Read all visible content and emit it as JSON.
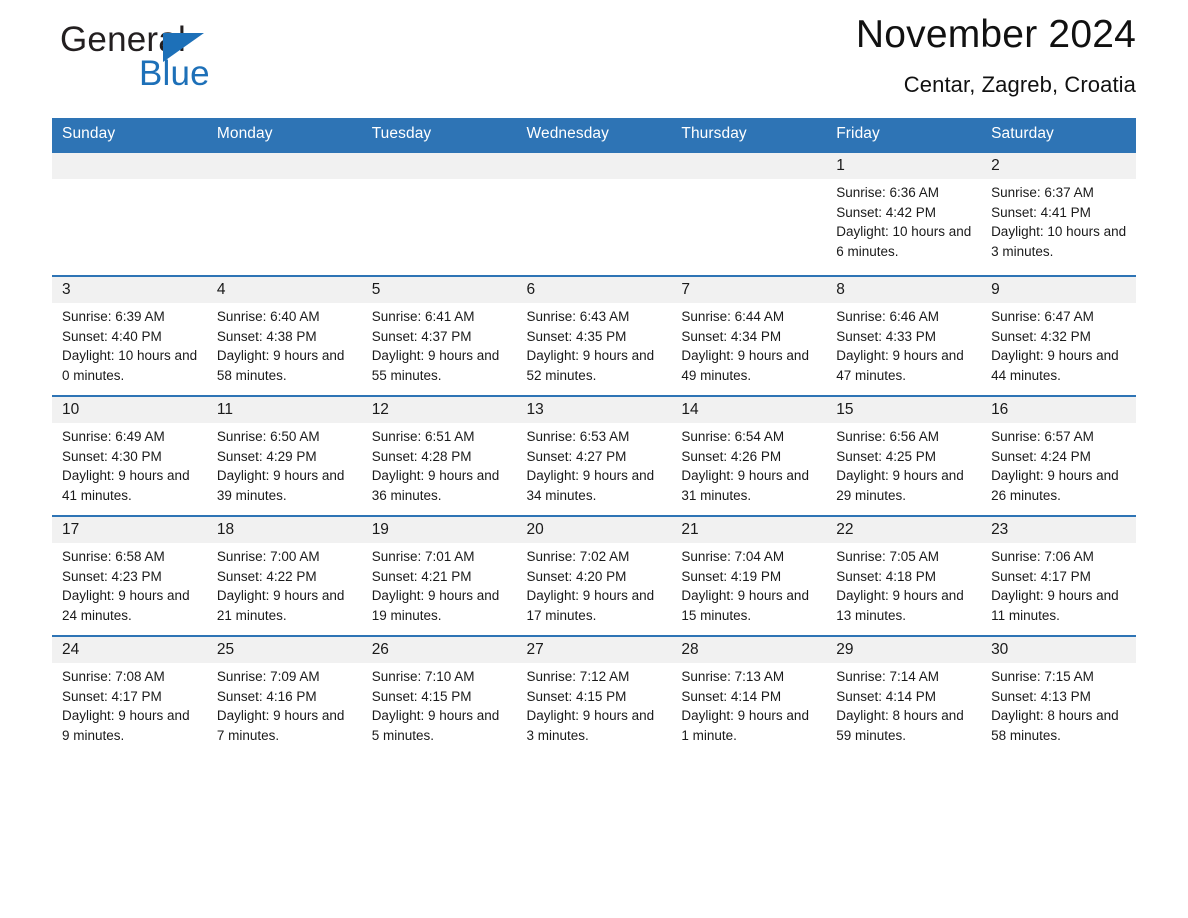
{
  "brand": {
    "name_part1": "General",
    "name_part2": "Blue",
    "logo_icon": "blue-triangle-icon"
  },
  "header": {
    "title": "November 2024",
    "location": "Centar, Zagreb, Croatia"
  },
  "colors": {
    "header_blue": "#2e74b5",
    "brand_blue": "#1d70b8",
    "daynum_band": "#f1f1f1",
    "text": "#1a1a1a",
    "page_background": "#ffffff"
  },
  "weekday_headers": [
    "Sunday",
    "Monday",
    "Tuesday",
    "Wednesday",
    "Thursday",
    "Friday",
    "Saturday"
  ],
  "labels": {
    "sunrise_prefix": "Sunrise:",
    "sunset_prefix": "Sunset:",
    "daylight_prefix": "Daylight:"
  },
  "weeks": [
    [
      {
        "day": "",
        "empty": true
      },
      {
        "day": "",
        "empty": true
      },
      {
        "day": "",
        "empty": true
      },
      {
        "day": "",
        "empty": true
      },
      {
        "day": "",
        "empty": true
      },
      {
        "day": "1",
        "sunrise": "Sunrise: 6:36 AM",
        "sunset": "Sunset: 4:42 PM",
        "daylight": "Daylight: 10 hours and 6 minutes."
      },
      {
        "day": "2",
        "sunrise": "Sunrise: 6:37 AM",
        "sunset": "Sunset: 4:41 PM",
        "daylight": "Daylight: 10 hours and 3 minutes."
      }
    ],
    [
      {
        "day": "3",
        "sunrise": "Sunrise: 6:39 AM",
        "sunset": "Sunset: 4:40 PM",
        "daylight": "Daylight: 10 hours and 0 minutes."
      },
      {
        "day": "4",
        "sunrise": "Sunrise: 6:40 AM",
        "sunset": "Sunset: 4:38 PM",
        "daylight": "Daylight: 9 hours and 58 minutes."
      },
      {
        "day": "5",
        "sunrise": "Sunrise: 6:41 AM",
        "sunset": "Sunset: 4:37 PM",
        "daylight": "Daylight: 9 hours and 55 minutes."
      },
      {
        "day": "6",
        "sunrise": "Sunrise: 6:43 AM",
        "sunset": "Sunset: 4:35 PM",
        "daylight": "Daylight: 9 hours and 52 minutes."
      },
      {
        "day": "7",
        "sunrise": "Sunrise: 6:44 AM",
        "sunset": "Sunset: 4:34 PM",
        "daylight": "Daylight: 9 hours and 49 minutes."
      },
      {
        "day": "8",
        "sunrise": "Sunrise: 6:46 AM",
        "sunset": "Sunset: 4:33 PM",
        "daylight": "Daylight: 9 hours and 47 minutes."
      },
      {
        "day": "9",
        "sunrise": "Sunrise: 6:47 AM",
        "sunset": "Sunset: 4:32 PM",
        "daylight": "Daylight: 9 hours and 44 minutes."
      }
    ],
    [
      {
        "day": "10",
        "sunrise": "Sunrise: 6:49 AM",
        "sunset": "Sunset: 4:30 PM",
        "daylight": "Daylight: 9 hours and 41 minutes."
      },
      {
        "day": "11",
        "sunrise": "Sunrise: 6:50 AM",
        "sunset": "Sunset: 4:29 PM",
        "daylight": "Daylight: 9 hours and 39 minutes."
      },
      {
        "day": "12",
        "sunrise": "Sunrise: 6:51 AM",
        "sunset": "Sunset: 4:28 PM",
        "daylight": "Daylight: 9 hours and 36 minutes."
      },
      {
        "day": "13",
        "sunrise": "Sunrise: 6:53 AM",
        "sunset": "Sunset: 4:27 PM",
        "daylight": "Daylight: 9 hours and 34 minutes."
      },
      {
        "day": "14",
        "sunrise": "Sunrise: 6:54 AM",
        "sunset": "Sunset: 4:26 PM",
        "daylight": "Daylight: 9 hours and 31 minutes."
      },
      {
        "day": "15",
        "sunrise": "Sunrise: 6:56 AM",
        "sunset": "Sunset: 4:25 PM",
        "daylight": "Daylight: 9 hours and 29 minutes."
      },
      {
        "day": "16",
        "sunrise": "Sunrise: 6:57 AM",
        "sunset": "Sunset: 4:24 PM",
        "daylight": "Daylight: 9 hours and 26 minutes."
      }
    ],
    [
      {
        "day": "17",
        "sunrise": "Sunrise: 6:58 AM",
        "sunset": "Sunset: 4:23 PM",
        "daylight": "Daylight: 9 hours and 24 minutes."
      },
      {
        "day": "18",
        "sunrise": "Sunrise: 7:00 AM",
        "sunset": "Sunset: 4:22 PM",
        "daylight": "Daylight: 9 hours and 21 minutes."
      },
      {
        "day": "19",
        "sunrise": "Sunrise: 7:01 AM",
        "sunset": "Sunset: 4:21 PM",
        "daylight": "Daylight: 9 hours and 19 minutes."
      },
      {
        "day": "20",
        "sunrise": "Sunrise: 7:02 AM",
        "sunset": "Sunset: 4:20 PM",
        "daylight": "Daylight: 9 hours and 17 minutes."
      },
      {
        "day": "21",
        "sunrise": "Sunrise: 7:04 AM",
        "sunset": "Sunset: 4:19 PM",
        "daylight": "Daylight: 9 hours and 15 minutes."
      },
      {
        "day": "22",
        "sunrise": "Sunrise: 7:05 AM",
        "sunset": "Sunset: 4:18 PM",
        "daylight": "Daylight: 9 hours and 13 minutes."
      },
      {
        "day": "23",
        "sunrise": "Sunrise: 7:06 AM",
        "sunset": "Sunset: 4:17 PM",
        "daylight": "Daylight: 9 hours and 11 minutes."
      }
    ],
    [
      {
        "day": "24",
        "sunrise": "Sunrise: 7:08 AM",
        "sunset": "Sunset: 4:17 PM",
        "daylight": "Daylight: 9 hours and 9 minutes."
      },
      {
        "day": "25",
        "sunrise": "Sunrise: 7:09 AM",
        "sunset": "Sunset: 4:16 PM",
        "daylight": "Daylight: 9 hours and 7 minutes."
      },
      {
        "day": "26",
        "sunrise": "Sunrise: 7:10 AM",
        "sunset": "Sunset: 4:15 PM",
        "daylight": "Daylight: 9 hours and 5 minutes."
      },
      {
        "day": "27",
        "sunrise": "Sunrise: 7:12 AM",
        "sunset": "Sunset: 4:15 PM",
        "daylight": "Daylight: 9 hours and 3 minutes."
      },
      {
        "day": "28",
        "sunrise": "Sunrise: 7:13 AM",
        "sunset": "Sunset: 4:14 PM",
        "daylight": "Daylight: 9 hours and 1 minute."
      },
      {
        "day": "29",
        "sunrise": "Sunrise: 7:14 AM",
        "sunset": "Sunset: 4:14 PM",
        "daylight": "Daylight: 8 hours and 59 minutes."
      },
      {
        "day": "30",
        "sunrise": "Sunrise: 7:15 AM",
        "sunset": "Sunset: 4:13 PM",
        "daylight": "Daylight: 8 hours and 58 minutes."
      }
    ]
  ]
}
